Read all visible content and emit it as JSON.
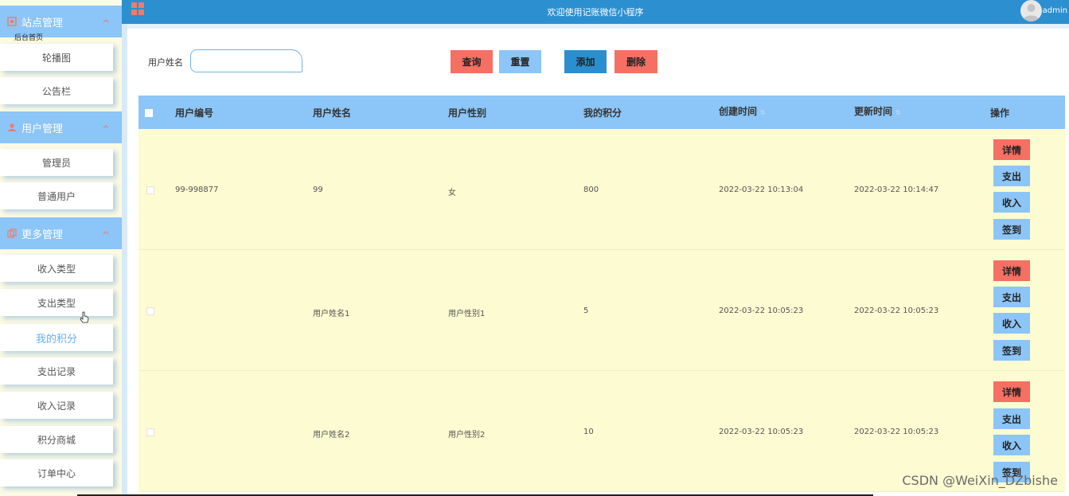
{
  "sidebar": {
    "groups": [
      {
        "label": "站点管理"
      },
      {
        "label": "用户管理"
      },
      {
        "label": "更多管理"
      }
    ],
    "corner_text": "后台首页",
    "items": [
      {
        "label": "轮播图"
      },
      {
        "label": "公告栏"
      },
      {
        "label": "管理员"
      },
      {
        "label": "普通用户"
      },
      {
        "label": "收入类型"
      },
      {
        "label": "支出类型"
      },
      {
        "label": "我的积分"
      },
      {
        "label": "支出记录"
      },
      {
        "label": "收入记录"
      },
      {
        "label": "积分商城"
      },
      {
        "label": "订单中心"
      }
    ]
  },
  "header": {
    "title": "欢迎使用记账微信小程序",
    "user": "admin"
  },
  "search": {
    "label": "用户姓名",
    "value": "",
    "placeholder": ""
  },
  "toolbar": {
    "query": "查询",
    "reset": "重置",
    "add": "添加",
    "delete": "删除"
  },
  "table": {
    "columns": [
      "用户编号",
      "用户姓名",
      "用户性别",
      "我的积分",
      "创建时间",
      "更新时间",
      "操作"
    ],
    "rows": [
      {
        "id": "99-998877",
        "name": "99",
        "gender": "女",
        "points": "800",
        "created": "2022-03-22 10:13:04",
        "updated": "2022-03-22 10:14:47"
      },
      {
        "id": "",
        "name": "用户姓名1",
        "gender": "用户性别1",
        "points": "5",
        "created": "2022-03-22 10:05:23",
        "updated": "2022-03-22 10:05:23"
      },
      {
        "id": "",
        "name": "用户姓名2",
        "gender": "用户性别2",
        "points": "10",
        "created": "2022-03-22 10:05:23",
        "updated": "2022-03-22 10:05:23"
      }
    ],
    "actions": [
      "详情",
      "支出",
      "收入",
      "签到"
    ]
  },
  "watermark": "CSDN @WeiXin_DZbishe",
  "colors": {
    "accent": "#8cc5f7",
    "header": "#2c8fd0",
    "danger": "#f56f63",
    "row_bg": "#fdfbd1"
  }
}
